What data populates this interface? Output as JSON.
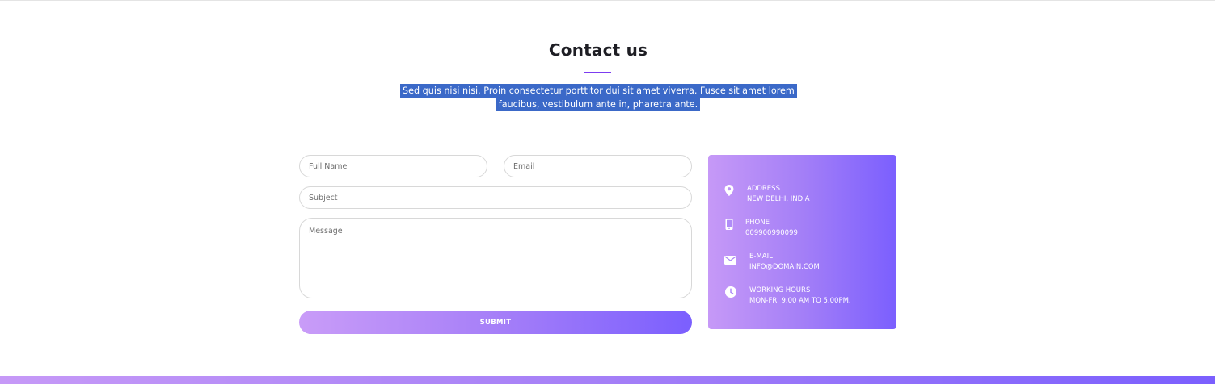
{
  "section": {
    "title": "Contact us",
    "intro": "Sed quis nisi nisi. Proin consectetur porttitor dui sit amet viverra. Fusce sit amet lorem faucibus, vestibulum ante in, pharetra ante."
  },
  "form": {
    "full_name_placeholder": "Full Name",
    "email_placeholder": "Email",
    "subject_placeholder": "Subject",
    "message_placeholder": "Message",
    "submit_label": "SUBMIT"
  },
  "contact_info": {
    "items": [
      {
        "icon": "location-pin-icon",
        "label": "ADDRESS",
        "value": "NEW DELHI, INDIA"
      },
      {
        "icon": "phone-icon",
        "label": "PHONE",
        "value": "009900990099"
      },
      {
        "icon": "envelope-icon",
        "label": "E-MAIL",
        "value": "INFO@DOMAIN.COM"
      },
      {
        "icon": "clock-icon",
        "label": "WORKING HOURS",
        "value": "MON-FRI 9.00 AM TO 5.00PM."
      }
    ]
  },
  "colors": {
    "accent": "#8a4bff",
    "gradient_start": "#c699f7",
    "gradient_end": "#7b5ffe",
    "selection_highlight": "#3b69c8"
  }
}
